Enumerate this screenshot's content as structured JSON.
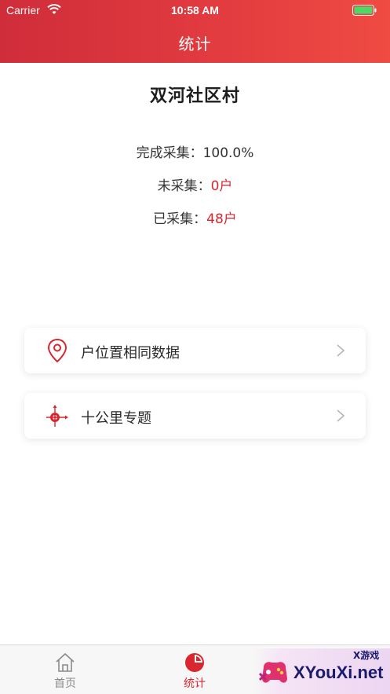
{
  "status_bar": {
    "carrier": "Carrier",
    "time": "10:58 AM"
  },
  "nav": {
    "title": "统计"
  },
  "summary": {
    "village_name": "双河社区村",
    "completed_label": "完成采集：",
    "completed_value": "100.0%",
    "uncollected_label": "未采集：",
    "uncollected_value": "0户",
    "collected_label": "已采集：",
    "collected_value": "48户"
  },
  "menu": [
    {
      "label": "户位置相同数据",
      "icon": "location-pin-icon"
    },
    {
      "label": "十公里专题",
      "icon": "target-crosshair-icon"
    }
  ],
  "tabs": [
    {
      "label": "首页",
      "icon": "home-icon",
      "active": false
    },
    {
      "label": "统计",
      "icon": "pie-chart-icon",
      "active": true
    }
  ],
  "watermark": {
    "text": "XYouXi.net",
    "small": "X游戏"
  },
  "colors": {
    "accent": "#d9262f",
    "header_start": "#cf2d3a",
    "header_end": "#ef4b42"
  }
}
